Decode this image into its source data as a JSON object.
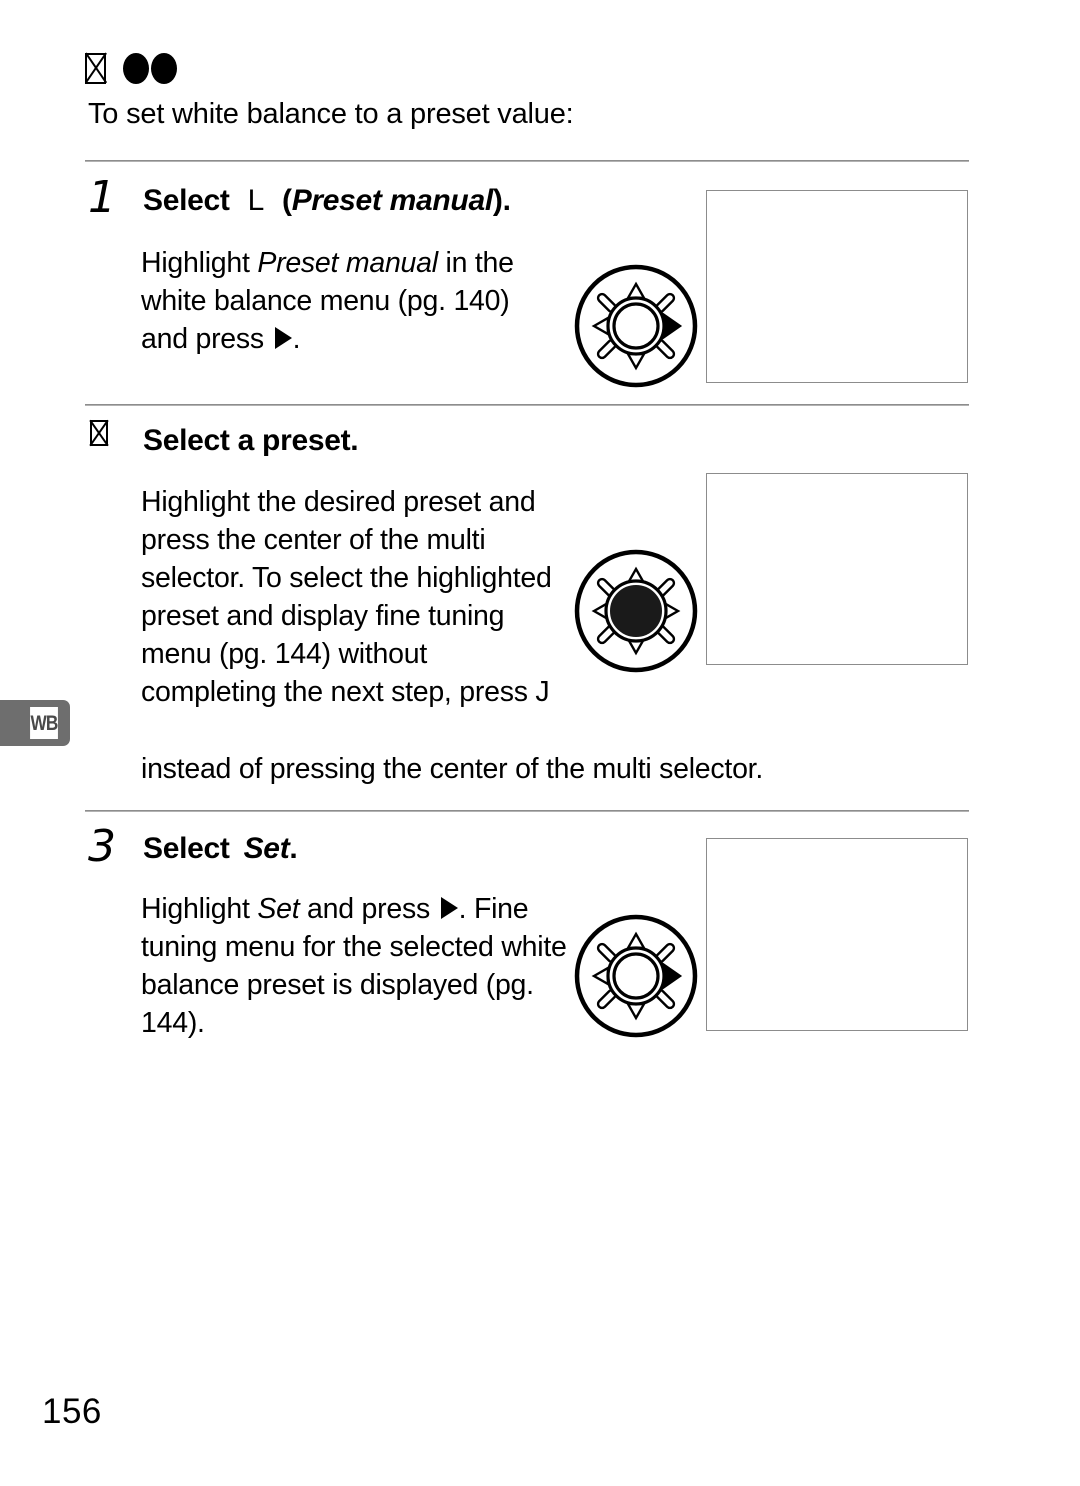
{
  "page": {
    "number": "156",
    "margin_tab_label": "WB"
  },
  "header": {
    "icon_missing_glyph": "missing-glyph-box-x",
    "bullet_count": 2,
    "intro_text": "To set white balance to a preset value:"
  },
  "steps": [
    {
      "number": "1",
      "number_is_glyph": false,
      "heading": {
        "lead": "Select",
        "glyph": "L",
        "paren_open": "(",
        "italic": "Preset manual",
        "paren_close": ").",
        "full": "Select L (Preset manual)."
      },
      "body_lines": [
        "Highlight Preset manual in the",
        "white balance menu (pg. 140)",
        "and press ▶."
      ],
      "body_parts": {
        "p1": "Highlight ",
        "italic": "Preset manual",
        "p2": " in the white balance menu (pg. ",
        "page_ref": "140",
        "p3": ") and press ",
        "p4": "."
      },
      "dial": {
        "name": "multi-selector-right",
        "highlighted_direction": "right",
        "center_filled": false
      },
      "screenshot_placeholder": "camera-menu-screenshot-1"
    },
    {
      "number": "2",
      "number_is_glyph": true,
      "heading": {
        "lead": "Select a preset.",
        "glyph": "",
        "full": "Select a preset."
      },
      "body_lines": [
        "Highlight the desired preset",
        "and press the center of the",
        "multi selector.  To select the",
        "highlighted preset and display",
        "fine tuning menu (pg. 144)",
        "without completing the next",
        "step, press J instead of",
        "pressing the center of the multi selector."
      ],
      "body_parts": {
        "p1": "Highlight the desired preset and press the center of the multi selector.  To select the highlighted preset and display fine tuning menu (pg. ",
        "page_ref": "144",
        "p2": ") without completing the next step, press ",
        "glyph": "J",
        "p3": " instead of pressing the center of the multi selector."
      },
      "dial": {
        "name": "multi-selector-center",
        "highlighted_direction": "center",
        "center_filled": true
      },
      "screenshot_placeholder": "camera-menu-screenshot-2"
    },
    {
      "number": "3",
      "number_is_glyph": false,
      "heading": {
        "lead": "Select",
        "italic": "Set",
        "period": ".",
        "full": "Select Set."
      },
      "body_lines": [
        "Highlight Set and press ▶.",
        "Fine tuning menu for the",
        "selected white balance preset",
        "is displayed (pg. 144)."
      ],
      "body_parts": {
        "p1": "Highlight ",
        "italic": "Set",
        "p2": " and press ",
        "p3": ". Fine tuning menu for the selected white balance preset is displayed (pg. ",
        "page_ref": "144",
        "p4": ")."
      },
      "dial": {
        "name": "multi-selector-right",
        "highlighted_direction": "right",
        "center_filled": false
      },
      "screenshot_placeholder": "camera-menu-screenshot-3"
    }
  ],
  "colors": {
    "rule": "#8d8d8d",
    "tab_background": "#6e6e6e",
    "box_border": "#8c8c8c",
    "ink": "#000000"
  }
}
